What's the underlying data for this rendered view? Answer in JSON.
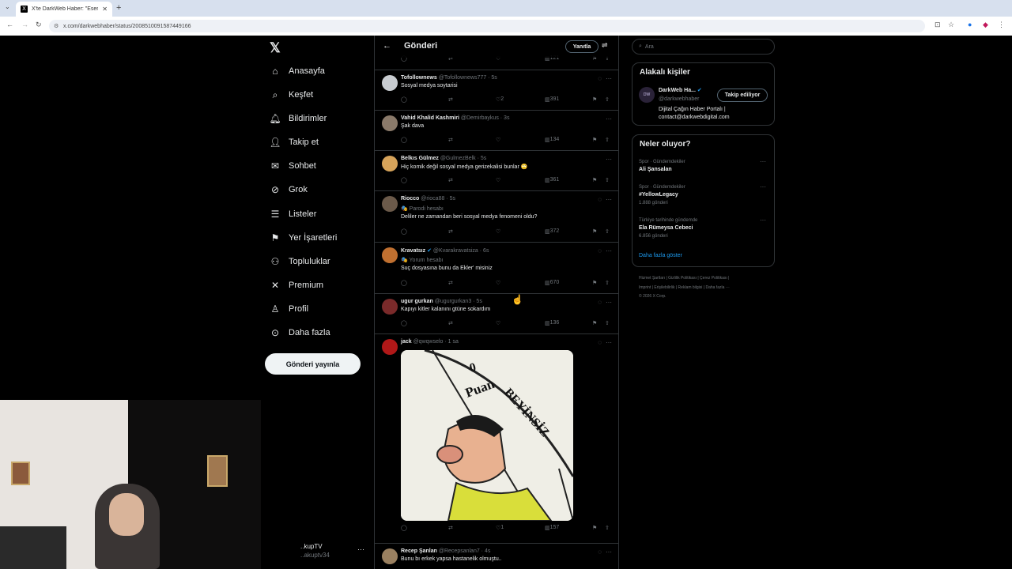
{
  "browser": {
    "tab_title": "X'te DarkWeb Haber: \"Esenyurt",
    "url": "x.com/darkwebhaber/status/2008510091587449166"
  },
  "nav": {
    "items": [
      "Anasayfa",
      "Keşfet",
      "Bildirimler",
      "Takip et",
      "Sohbet",
      "Grok",
      "Listeler",
      "Yer İşaretleri",
      "Topluluklar",
      "Premium",
      "Profil",
      "Daha fazla"
    ],
    "post_button": "Gönderi yayınla",
    "account_name": "..kupTV",
    "account_handle": "..akuptv34"
  },
  "main": {
    "title": "Gönderi",
    "reply_button": "Yanıtla",
    "top_stats": {
      "views": "121"
    },
    "tweets": [
      {
        "name": "Tofollownews",
        "handle": "@Tofollownews777 · 5s",
        "badge": "",
        "text": "Sosyal medya soytarisi",
        "reply": "",
        "rt": "",
        "like": "2",
        "views": "391"
      },
      {
        "name": "Vahid Khalid Kashmiri",
        "handle": "@Demirbaykus · 3s",
        "badge": "",
        "text": "Şak dava",
        "reply": "",
        "rt": "",
        "like": "",
        "views": "134"
      },
      {
        "name": "Belkıs Gülmez",
        "handle": "@GulmezBelk · 5s",
        "badge": "",
        "text": "Hiç komik değil sosyal medya gerizekalisi bunlar 🙄",
        "reply": "",
        "rt": "",
        "like": "",
        "views": "361"
      },
      {
        "name": "Riocco",
        "handle": "@rioca88 · 5s",
        "badge": "🎭 Parodi hesabı",
        "text": "Deliler ne zamandan beri sosyal medya fenomeni oldu?",
        "reply": "",
        "rt": "",
        "like": "",
        "views": "372"
      },
      {
        "name": "Kravatsız",
        "handle": "@Kvarakravatsiza · 6s",
        "badge": "🎭 Yorum hesabı",
        "text": "Suç dosyasına bunu da Ekler' misiniz",
        "reply": "",
        "rt": "",
        "like": "",
        "views": "670"
      },
      {
        "name": "ugur gurkan",
        "handle": "@ugurgurkan3 · 5s",
        "badge": "",
        "text": "Kapıyı kitler kalanını gtüne sokardım",
        "reply": "",
        "rt": "",
        "like": "",
        "views": "136"
      },
      {
        "name": "jack",
        "handle": "@qwqwselo · 1 sa",
        "badge": "",
        "text": "",
        "reply": "",
        "rt": "",
        "like": "1",
        "views": "157",
        "meme_text_1": "0",
        "meme_text_2": "Puan",
        "meme_text_3": "BEYİNSİZ"
      },
      {
        "name": "Recep Şanlan",
        "handle": "@Recepsanlan7 · 4s",
        "badge": "",
        "text": "Bunu bı erkek yapsa hastanelik olmuştu..",
        "reply": "",
        "rt": "",
        "like": "",
        "views": ""
      }
    ]
  },
  "sidebar": {
    "search_placeholder": "Ara",
    "people_title": "Alakalı kişiler",
    "person_name": "DarkWeb Ha...",
    "person_handle": "@darkwebhaber",
    "person_bio_1": "Dijital Çağın Haber Portalı |",
    "person_bio_2": "contact@darkwebdigital.com",
    "follow_label": "Takip ediliyor",
    "trends_title": "Neler oluyor?",
    "trends": [
      {
        "cat": "Spor · Gündemdekiler",
        "name": "Ali Şansalan",
        "count": ""
      },
      {
        "cat": "Spor · Gündemdekiler",
        "name": "#YellowLegacy",
        "count": "1.888 gönderi"
      },
      {
        "cat": "Türkiye tarihinde gündemde",
        "name": "Ela Rümeysa Cebeci",
        "count": "6.856 gönderi"
      }
    ],
    "show_more": "Daha fazla göster",
    "footer_1": "Hizmet Şartları  |  Gizlilik Politikası  |  Çerez Politikası  |",
    "footer_2": "Imprint  |  Erişilebilirlik  |  Reklam bilgisi  |  Daha fazla ···",
    "footer_3": "© 2026 X Corp."
  }
}
